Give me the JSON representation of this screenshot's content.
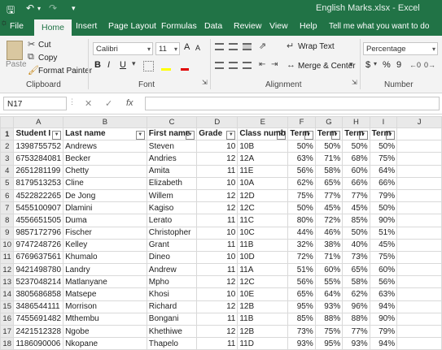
{
  "window": {
    "title": "English Marks.xlsx  -  Excel"
  },
  "tabs": [
    "File",
    "Home",
    "Insert",
    "Page Layout",
    "Formulas",
    "Data",
    "Review",
    "View",
    "Help"
  ],
  "tell_me": "Tell me what you want to do",
  "ribbon": {
    "clipboard": {
      "paste": "Paste",
      "cut": "Cut",
      "copy": "Copy",
      "format_painter": "Format Painter",
      "label": "Clipboard"
    },
    "font": {
      "name": "Calibri",
      "size": "11",
      "bold": "B",
      "italic": "I",
      "underline": "U",
      "grow": "A",
      "shrink": "A",
      "label": "Font"
    },
    "alignment": {
      "wrap": "Wrap Text",
      "merge": "Merge & Center",
      "label": "Alignment"
    },
    "number": {
      "format": "Percentage",
      "currency": "$",
      "percent": "%",
      "comma": "9",
      "label": "Number"
    }
  },
  "formula_bar": {
    "name_box": "N17",
    "fx": "fx",
    "value": ""
  },
  "columns": [
    "A",
    "B",
    "C",
    "D",
    "E",
    "F",
    "G",
    "H",
    "I",
    "J"
  ],
  "headers": [
    "Student I",
    "Last name",
    "First name",
    "Grade",
    "Class numb",
    "Term",
    "Term",
    "Term",
    "Term"
  ],
  "rows": [
    [
      "1398755752",
      "Andrews",
      "Steven",
      "10",
      "10B",
      "50%",
      "50%",
      "50%",
      "50%"
    ],
    [
      "6753284081",
      "Becker",
      "Andries",
      "12",
      "12A",
      "63%",
      "71%",
      "68%",
      "75%"
    ],
    [
      "2651281199",
      "Chetty",
      "Amita",
      "11",
      "11E",
      "56%",
      "58%",
      "60%",
      "64%"
    ],
    [
      "8179513253",
      "Cline",
      "Elizabeth",
      "10",
      "10A",
      "62%",
      "65%",
      "66%",
      "66%"
    ],
    [
      "4522822265",
      "De Jong",
      "Willem",
      "12",
      "12D",
      "75%",
      "77%",
      "77%",
      "79%"
    ],
    [
      "5455100907",
      "Dlamini",
      "Kagiso",
      "12",
      "12C",
      "50%",
      "45%",
      "45%",
      "50%"
    ],
    [
      "4556651505",
      "Duma",
      "Lerato",
      "11",
      "11C",
      "80%",
      "72%",
      "85%",
      "90%"
    ],
    [
      "9857172796",
      "Fischer",
      "Christopher",
      "10",
      "10C",
      "44%",
      "46%",
      "50%",
      "51%"
    ],
    [
      "9747248726",
      "Kelley",
      "Grant",
      "11",
      "11B",
      "32%",
      "38%",
      "40%",
      "45%"
    ],
    [
      "6769637561",
      "Khumalo",
      "Dineo",
      "10",
      "10D",
      "72%",
      "71%",
      "73%",
      "75%"
    ],
    [
      "9421498780",
      "Landry",
      "Andrew",
      "11",
      "11A",
      "51%",
      "60%",
      "65%",
      "60%"
    ],
    [
      "5237048214",
      "Matlanyane",
      "Mpho",
      "12",
      "12C",
      "56%",
      "55%",
      "58%",
      "56%"
    ],
    [
      "3805686858",
      "Matsepe",
      "Khosi",
      "10",
      "10E",
      "65%",
      "64%",
      "62%",
      "63%"
    ],
    [
      "3486544111",
      "Morrison",
      "Richard",
      "12",
      "12B",
      "95%",
      "93%",
      "96%",
      "94%"
    ],
    [
      "7455691482",
      "Mthembu",
      "Bongani",
      "11",
      "11B",
      "85%",
      "88%",
      "88%",
      "90%"
    ],
    [
      "2421512328",
      "Ngobe",
      "Khethiwe",
      "12",
      "12B",
      "73%",
      "75%",
      "77%",
      "79%"
    ],
    [
      "1186090006",
      "Nkopane",
      "Thapelo",
      "11",
      "11D",
      "93%",
      "95%",
      "93%",
      "94%"
    ]
  ]
}
